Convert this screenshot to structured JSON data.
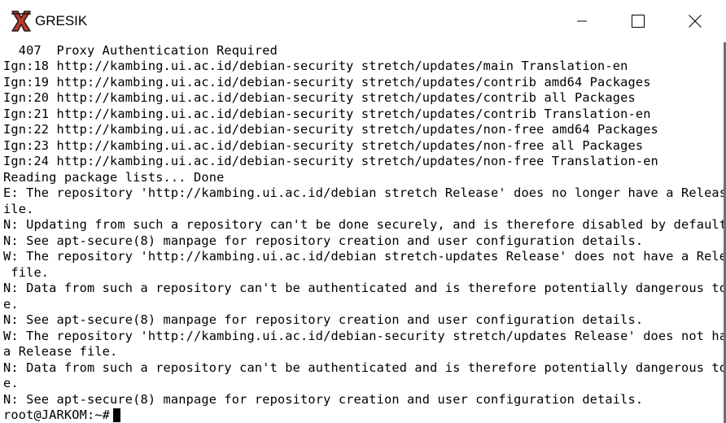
{
  "window": {
    "title": "GRESIK",
    "controls": {
      "minimize_icon": "minimize-icon",
      "maximize_icon": "maximize-icon",
      "close_icon": "close-icon"
    },
    "app_icon": "xterm-x-icon",
    "app_icon_color": "#c0392b"
  },
  "terminal": {
    "lines": [
      "  407  Proxy Authentication Required",
      "Ign:18 http://kambing.ui.ac.id/debian-security stretch/updates/main Translation-en",
      "Ign:19 http://kambing.ui.ac.id/debian-security stretch/updates/contrib amd64 Packages",
      "Ign:20 http://kambing.ui.ac.id/debian-security stretch/updates/contrib all Packages",
      "Ign:21 http://kambing.ui.ac.id/debian-security stretch/updates/contrib Translation-en",
      "Ign:22 http://kambing.ui.ac.id/debian-security stretch/updates/non-free amd64 Packages",
      "Ign:23 http://kambing.ui.ac.id/debian-security stretch/updates/non-free all Packages",
      "Ign:24 http://kambing.ui.ac.id/debian-security stretch/updates/non-free Translation-en",
      "Reading package lists... Done",
      "E: The repository 'http://kambing.ui.ac.id/debian stretch Release' does no longer have a Release f",
      "ile.",
      "N: Updating from such a repository can't be done securely, and is therefore disabled by default.",
      "N: See apt-secure(8) manpage for repository creation and user configuration details.",
      "W: The repository 'http://kambing.ui.ac.id/debian stretch-updates Release' does not have a Release",
      " file.",
      "N: Data from such a repository can't be authenticated and is therefore potentially dangerous to us",
      "e.",
      "N: See apt-secure(8) manpage for repository creation and user configuration details.",
      "W: The repository 'http://kambing.ui.ac.id/debian-security stretch/updates Release' does not have",
      "a Release file.",
      "N: Data from such a repository can't be authenticated and is therefore potentially dangerous to us",
      "e.",
      "N: See apt-secure(8) manpage for repository creation and user configuration details."
    ],
    "prompt": "root@JARKOM:~#"
  }
}
